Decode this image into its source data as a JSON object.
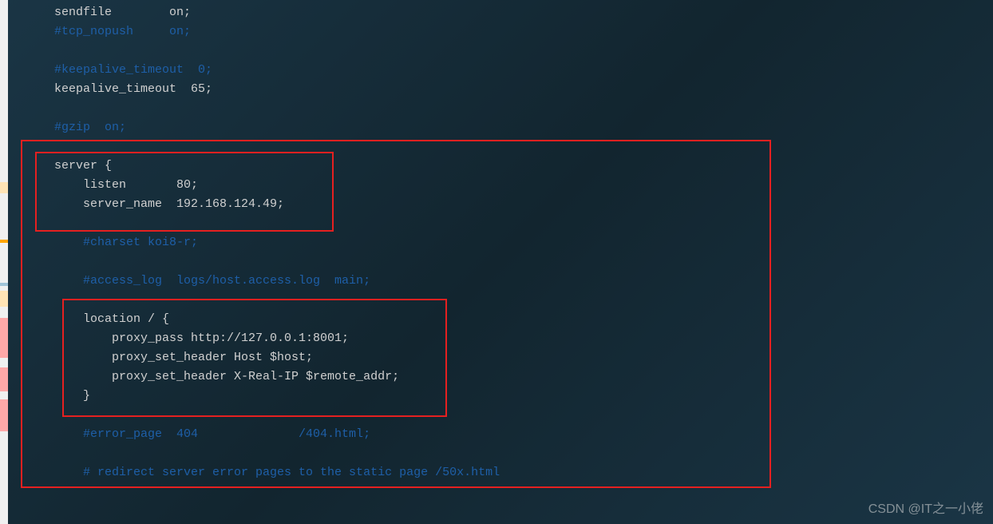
{
  "lines": {
    "l1": "sendfile        on;",
    "l2": "#tcp_nopush     on;",
    "l3": "",
    "l4": "#keepalive_timeout  0;",
    "l5": "keepalive_timeout  65;",
    "l6": "",
    "l7": "#gzip  on;",
    "l8": "",
    "l9": "server {",
    "l10": "    listen       80;",
    "l11": "    server_name  192.168.124.49;",
    "l12": "",
    "l13": "    #charset koi8-r;",
    "l14": "",
    "l15": "    #access_log  logs/host.access.log  main;",
    "l16": "",
    "l17": "    location / {",
    "l18": "        proxy_pass http://127.0.0.1:8001;",
    "l19": "        proxy_set_header Host $host;",
    "l20": "        proxy_set_header X-Real-IP $remote_addr;",
    "l21": "    }",
    "l22": "",
    "l23": "    #error_page  404              /404.html;",
    "l24": "",
    "l25": "    # redirect server error pages to the static page /50x.html"
  },
  "watermark": "CSDN @IT之一小佬"
}
